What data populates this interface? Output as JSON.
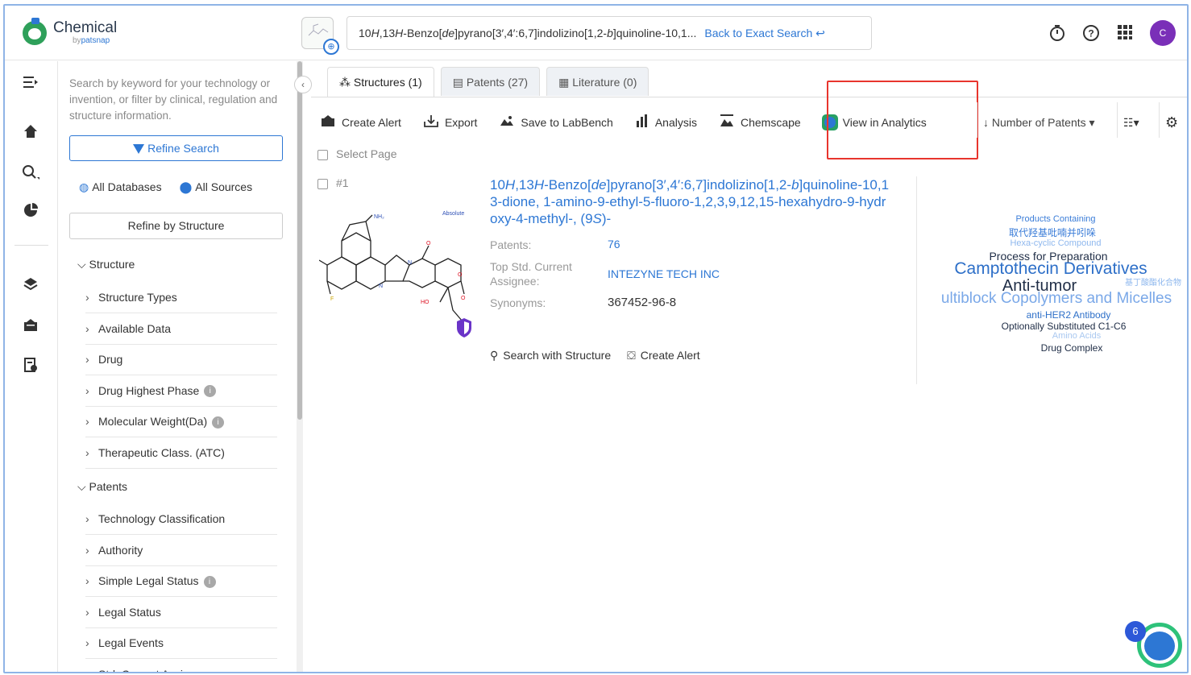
{
  "app": {
    "name": "Chemical",
    "by": "by",
    "brand": "patsnap",
    "avatar_letter": "C"
  },
  "query": {
    "text_html": "10<i>H</i>,13<i>H</i>-Benzo[<i>de</i>]pyrano[3′,4′:6,7]indolizino[1,2-<i>b</i>]quinoline-10,1...",
    "back_label": "Back to Exact Search"
  },
  "filter": {
    "hint": "Search by keyword for your technology or invention, or filter by clinical, regulation and structure information.",
    "refine_search": "Refine Search",
    "all_databases": "All Databases",
    "all_sources": "All Sources",
    "refine_structure": "Refine by Structure",
    "section_structure": "Structure",
    "section_patents": "Patents",
    "structure_items": [
      {
        "label": "Structure Types",
        "info": false
      },
      {
        "label": "Available Data",
        "info": false
      },
      {
        "label": "Drug",
        "info": false
      },
      {
        "label": "Drug Highest Phase",
        "info": true
      },
      {
        "label": "Molecular Weight(Da)",
        "info": true
      },
      {
        "label": "Therapeutic Class. (ATC)",
        "info": false
      }
    ],
    "patent_items": [
      {
        "label": "Technology Classification",
        "info": false
      },
      {
        "label": "Authority",
        "info": false
      },
      {
        "label": "Simple Legal Status",
        "info": true
      },
      {
        "label": "Legal Status",
        "info": false
      },
      {
        "label": "Legal Events",
        "info": false
      },
      {
        "label": "Std. Current Assignee",
        "info": false
      }
    ]
  },
  "tabs": [
    {
      "label": "Structures (1)",
      "active": true
    },
    {
      "label": "Patents (27)",
      "active": false
    },
    {
      "label": "Literature (0)",
      "active": false
    }
  ],
  "toolbar": {
    "create_alert": "Create Alert",
    "export": "Export",
    "save_labbench": "Save to LabBench",
    "analysis": "Analysis",
    "chemscape": "Chemscape",
    "view_analytics": "View in Analytics",
    "sort": "Number of Patents"
  },
  "results": {
    "select_page": "Select Page",
    "row_number": "#1",
    "absolute_label": "Absolute",
    "title_html": "10<i>H</i>,13<i>H</i>-Benzo[<i>de</i>]pyrano[3′,4′:6,7]indolizino[1,2-<i>b</i>]quinoline-10,13-dione, 1-amino-9-ethyl-5-fluoro-1,2,3,9,12,15-hexahydro-9-hydroxy-4-methyl-, (9<i>S</i>)-",
    "patents_key": "Patents:",
    "patents_value": "76",
    "assignee_key": "Top Std. Current Assignee:",
    "assignee_value": "INTEZYNE TECH INC",
    "synonyms_key": "Synonyms:",
    "synonyms_value": "367452-96-8",
    "search_with_structure": "Search with Structure",
    "create_alert": "Create Alert",
    "atom_labels": {
      "nh2": "NH₂",
      "n1": "N",
      "n2": "N",
      "o1": "O",
      "o2": "O",
      "o3": "O",
      "ho": "HO",
      "f": "F"
    }
  },
  "word_cloud": [
    {
      "text": "Products Containing",
      "color": "#3b7dd8",
      "size": 11
    },
    {
      "text": "取代羟基吡喃并吲哚",
      "color": "#3b7dd8",
      "size": 12
    },
    {
      "text": "Hexa-cyclic Compound",
      "color": "#8fb8ee",
      "size": 11
    },
    {
      "text": "Process for Preparation",
      "color": "#1f2d46",
      "size": 14
    },
    {
      "text": "Camptothecin Derivatives",
      "color": "#2d6fc8",
      "size": 21
    },
    {
      "text": "Anti-tumor",
      "color": "#1f2d46",
      "size": 20
    },
    {
      "text": "基丁酸酯化合物",
      "color": "#8fb8ee",
      "size": 10
    },
    {
      "text": "ultiblock Copolymers and Micelles",
      "color": "#7aa8e8",
      "size": 19
    },
    {
      "text": "anti-HER2 Antibody",
      "color": "#2d6fc8",
      "size": 12
    },
    {
      "text": "Optionally Substituted C1-C6",
      "color": "#1f2d46",
      "size": 12
    },
    {
      "text": "Amino Acids",
      "color": "#a9c8f0",
      "size": 11
    },
    {
      "text": "Drug Complex",
      "color": "#1f2d46",
      "size": 12
    }
  ],
  "float_badge": "6",
  "colors": {
    "accent": "#2d77d4",
    "highlight": "#e8352d",
    "avatar": "#7a2fb8"
  }
}
